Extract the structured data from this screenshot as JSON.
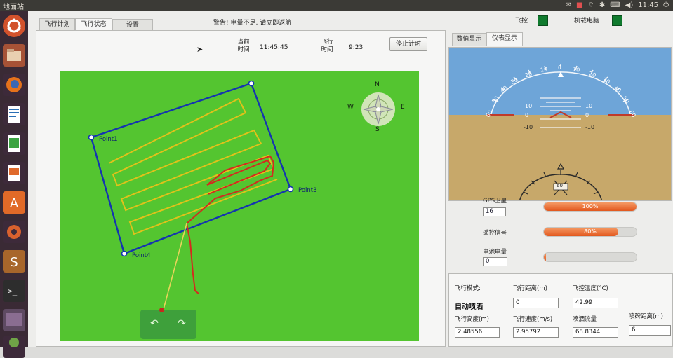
{
  "window": {
    "title": "地面站"
  },
  "tray": {
    "clock": "11:45"
  },
  "tabs": [
    "飞行计划",
    "飞行状态",
    "设置"
  ],
  "alert": "警告! 电量不足, 请立即返航",
  "status": {
    "flight_ctrl_label": "飞控",
    "onboard_pc_label": "机载电脑",
    "led_color": "#0f7a2d"
  },
  "timer": {
    "current_time_label": "当前\n时间",
    "current_time": "11:45:45",
    "flight_time_label": "飞行\n时间",
    "flight_time": "9:23",
    "stop_button": "停止计时"
  },
  "map": {
    "points": [
      "Point1",
      "Point3",
      "Point4"
    ],
    "compass": {
      "n": "N",
      "s": "S",
      "e": "E",
      "w": "W"
    }
  },
  "right_tabs": [
    "数值显示",
    "仪表显示"
  ],
  "attitude": {
    "scale_labels": [
      "60",
      "50",
      "40",
      "30",
      "20",
      "10",
      "0",
      "10",
      "20",
      "30",
      "40",
      "50",
      "60"
    ],
    "pitch_labels": [
      "10",
      "0",
      "-10",
      "10",
      "0",
      "-10"
    ],
    "heading_value": "60"
  },
  "indicators": [
    {
      "label": "GPS卫星",
      "value": "16",
      "fill": 1.0,
      "pct": "100%"
    },
    {
      "label": "遥控信号",
      "value": "",
      "fill": 0.8,
      "pct": "80%"
    },
    {
      "label": "电池电量",
      "value": "0",
      "fill": 0.0,
      "pct": ""
    }
  ],
  "stats": {
    "flight_mode_label": "飞行模式:",
    "flight_mode": "自动喷洒",
    "distance_label": "飞行距离(m)",
    "distance": "0",
    "temp_label": "飞控温度(°C)",
    "temp": "42.99",
    "altitude_label": "飞行高度(m)",
    "altitude": "2.48556",
    "speed_label": "飞行速度(m/s)",
    "speed": "2.95792",
    "flow_label": "喷洒流量",
    "flow": "68.8344",
    "spray_dist_label": "喷碑距离(m)",
    "spray_dist": "6"
  }
}
